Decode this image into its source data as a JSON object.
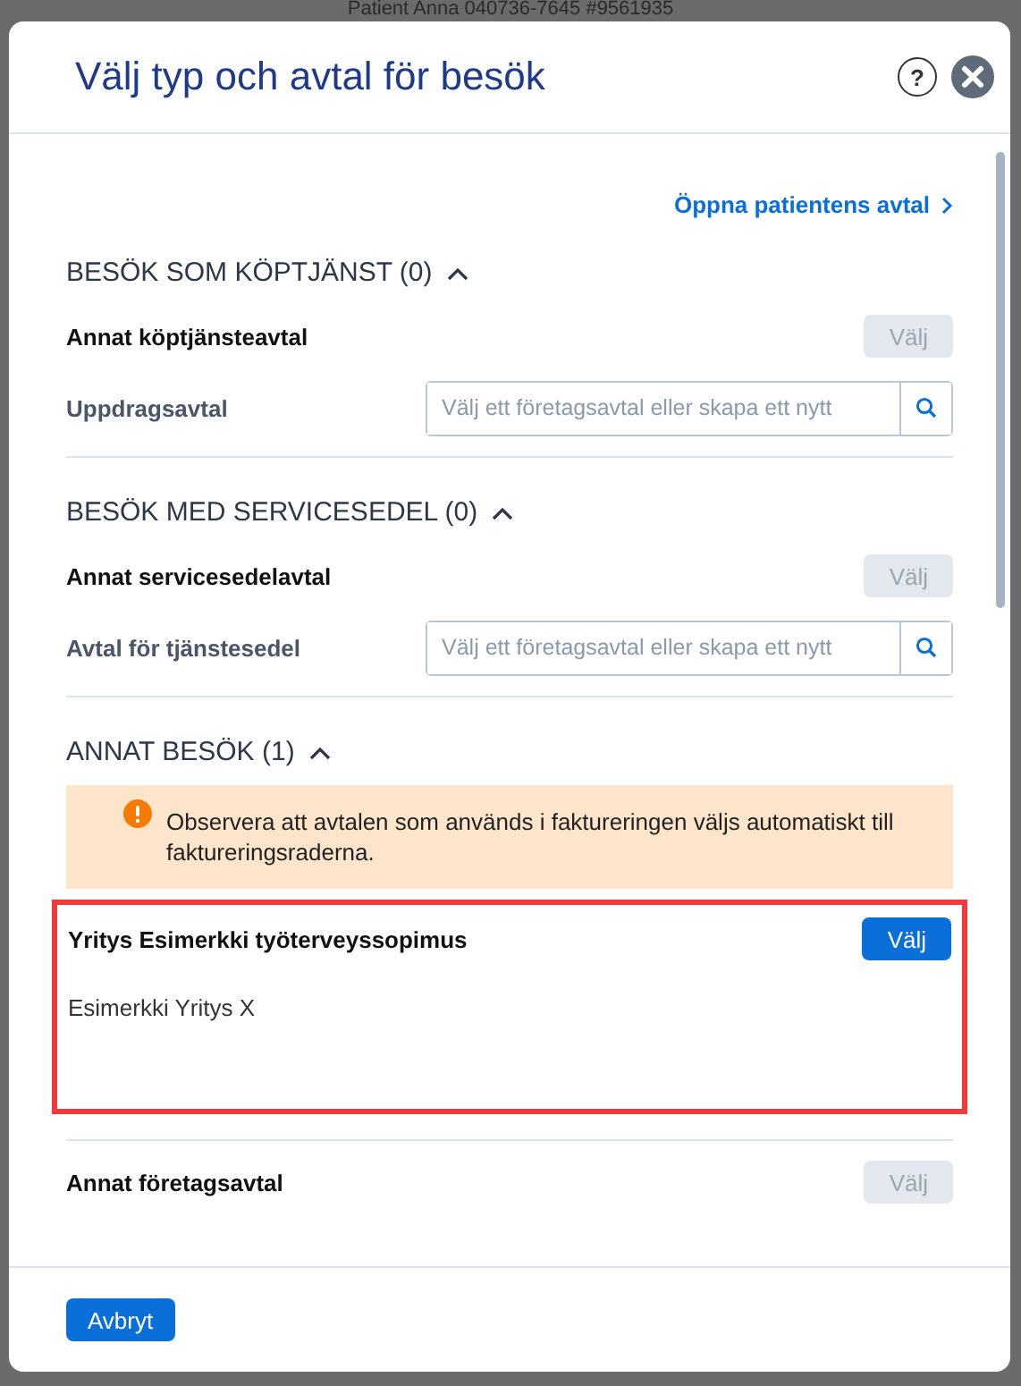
{
  "background": {
    "patient_header": "Patient Anna 040736-7645 #9561935"
  },
  "dialog": {
    "title": "Välj typ och avtal för besök",
    "help_button": "?",
    "link": "Öppna patientens avtal",
    "sections": [
      {
        "title": "BESÖK SOM KÖPTJÄNST (0)",
        "expanded": true,
        "items": [
          {
            "kind": "option",
            "label": "Annat köptjänsteavtal",
            "button": {
              "label": "Välj",
              "disabled": true
            }
          },
          {
            "kind": "search",
            "label": "Uppdragsavtal",
            "placeholder": "Välj ett företagsavtal eller skapa ett nytt"
          }
        ]
      },
      {
        "title": "BESÖK MED SERVICESEDEL (0)",
        "expanded": true,
        "items": [
          {
            "kind": "option",
            "label": "Annat servicesedelavtal",
            "button": {
              "label": "Välj",
              "disabled": true
            }
          },
          {
            "kind": "search",
            "label": "Avtal för tjänstesedel",
            "placeholder": "Välj ett företagsavtal eller skapa ett nytt"
          }
        ]
      },
      {
        "title": "ANNAT BESÖK (1)",
        "expanded": true,
        "items": [
          {
            "kind": "notice",
            "text": "Observera att avtalen som används i faktureringen väljs automatiskt till faktureringsraderna."
          },
          {
            "kind": "agreement",
            "selected": true,
            "label": "Yritys Esimerkki työterveyssopimus",
            "company": "Esimerkki Yritys X",
            "button": {
              "label": "Välj",
              "disabled": false
            }
          },
          {
            "kind": "option",
            "label": "Annat företagsavtal",
            "button": {
              "label": "Välj",
              "disabled": true
            }
          }
        ]
      }
    ],
    "footer_button": "Avbryt"
  }
}
